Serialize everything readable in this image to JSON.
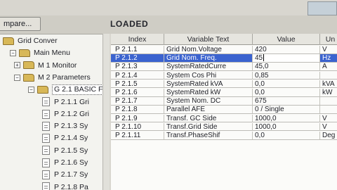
{
  "toolbar": {
    "compare_label": "mpare..."
  },
  "status": {
    "text": "LOADED"
  },
  "tree": {
    "items": [
      {
        "label": "Grid Conver",
        "level": 0,
        "kind": "folder",
        "expander": ""
      },
      {
        "label": "Main Menu",
        "level": 1,
        "kind": "folder",
        "expander": "−"
      },
      {
        "label": "M 1 Monitor",
        "level": 2,
        "kind": "folder",
        "expander": "+"
      },
      {
        "label": "M 2 Parameters",
        "level": 2,
        "kind": "folder",
        "expander": "−"
      },
      {
        "label": "G 2.1 BASIC F",
        "level": 3,
        "kind": "folder",
        "expander": "−",
        "selected": true
      },
      {
        "label": "P 2.1.1 Gri",
        "level": 4,
        "kind": "doc"
      },
      {
        "label": "P 2.1.2 Gri",
        "level": 4,
        "kind": "doc"
      },
      {
        "label": "P 2.1.3 Sy",
        "level": 4,
        "kind": "doc"
      },
      {
        "label": "P 2.1.4 Sy",
        "level": 4,
        "kind": "doc"
      },
      {
        "label": "P 2.1.5 Sy",
        "level": 4,
        "kind": "doc"
      },
      {
        "label": "P 2.1.6 Sy",
        "level": 4,
        "kind": "doc"
      },
      {
        "label": "P 2.1.7 Sy",
        "level": 4,
        "kind": "doc"
      },
      {
        "label": "P 2.1.8 Pa",
        "level": 4,
        "kind": "doc"
      }
    ]
  },
  "grid": {
    "columns": [
      "Index",
      "Variable Text",
      "Value",
      "Un"
    ],
    "rows": [
      {
        "index": "P 2.1.1",
        "variable": "Grid Nom.Voltage",
        "value": "420",
        "unit": "V"
      },
      {
        "index": "P 2.1.2",
        "variable": "Grid Nom. Freq.",
        "value": "45",
        "unit": "Hz",
        "selected": true
      },
      {
        "index": "P 2.1.3",
        "variable": "SystemRatedCurre",
        "value": "45,0",
        "unit": "A"
      },
      {
        "index": "P 2.1.4",
        "variable": "System Cos Phi",
        "value": "0,85",
        "unit": ""
      },
      {
        "index": "P 2.1.5",
        "variable": "SystemRated kVA",
        "value": "0,0",
        "unit": "kVA"
      },
      {
        "index": "P 2.1.6",
        "variable": "SystemRated kW",
        "value": "0,0",
        "unit": "kW"
      },
      {
        "index": "P 2.1.7",
        "variable": "System Nom. DC",
        "value": "675",
        "unit": ""
      },
      {
        "index": "P 2.1.8",
        "variable": "Parallel AFE",
        "value": "0 / Single",
        "unit": ""
      },
      {
        "index": "P 2.1.9",
        "variable": "Transf. GC Side",
        "value": "1000,0",
        "unit": "V"
      },
      {
        "index": "P 2.1.10",
        "variable": "Transf.Grid Side",
        "value": "1000,0",
        "unit": "V"
      },
      {
        "index": "P 2.1.11",
        "variable": "Transf.PhaseShif",
        "value": "0,0",
        "unit": "Deg"
      }
    ]
  }
}
